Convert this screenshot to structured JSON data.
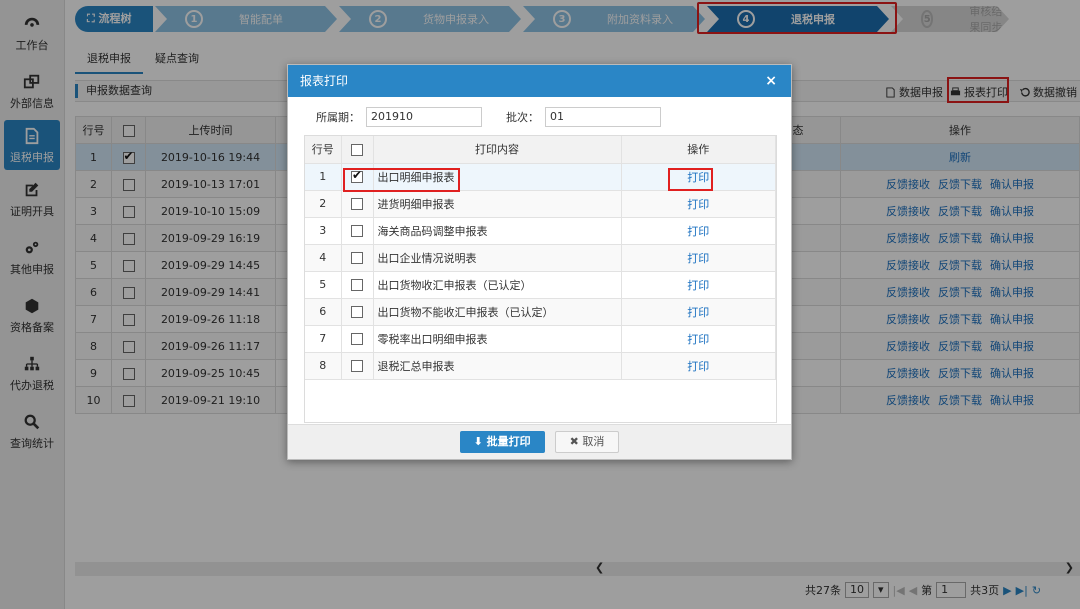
{
  "sidebar": {
    "items": [
      {
        "label": "工作台",
        "icon": "dashboard-icon"
      },
      {
        "label": "外部信息",
        "icon": "windows-icon"
      },
      {
        "label": "退税申报",
        "icon": "document-icon",
        "active": true
      },
      {
        "label": "证明开具",
        "icon": "edit-icon"
      },
      {
        "label": "其他申报",
        "icon": "gears-icon"
      },
      {
        "label": "资格备案",
        "icon": "cube-icon"
      },
      {
        "label": "代办退税",
        "icon": "hierarchy-icon"
      },
      {
        "label": "查询统计",
        "icon": "search-icon"
      }
    ]
  },
  "flow": {
    "root": "流程树",
    "steps": [
      {
        "num": "1",
        "label": "智能配单"
      },
      {
        "num": "2",
        "label": "货物申报录入"
      },
      {
        "num": "3",
        "label": "附加资料录入"
      },
      {
        "num": "4",
        "label": "退税申报"
      },
      {
        "num": "5",
        "label": "审核结果同步"
      }
    ]
  },
  "tabs": [
    "退税申报",
    "疑点查询"
  ],
  "panel": {
    "title": "申报数据查询",
    "actions": [
      "数据申报",
      "报表打印",
      "数据撤销"
    ]
  },
  "main_table": {
    "headers": {
      "row": "行号",
      "time": "上传时间",
      "partial": "态",
      "ops": "操作"
    },
    "rows": [
      {
        "no": "1",
        "time": "2019-10-16 19:44",
        "checked": true,
        "ops": [
          "刷新"
        ]
      },
      {
        "no": "2",
        "time": "2019-10-13 17:01",
        "ops": [
          "反馈接收",
          "反馈下载",
          "确认申报"
        ]
      },
      {
        "no": "3",
        "time": "2019-10-10 15:09",
        "ops": [
          "反馈接收",
          "反馈下载",
          "确认申报"
        ]
      },
      {
        "no": "4",
        "time": "2019-09-29 16:19",
        "ops": [
          "反馈接收",
          "反馈下载",
          "确认申报"
        ]
      },
      {
        "no": "5",
        "time": "2019-09-29 14:45",
        "ops": [
          "反馈接收",
          "反馈下载",
          "确认申报"
        ]
      },
      {
        "no": "6",
        "time": "2019-09-29 14:41",
        "ops": [
          "反馈接收",
          "反馈下载",
          "确认申报"
        ]
      },
      {
        "no": "7",
        "time": "2019-09-26 11:18",
        "ops": [
          "反馈接收",
          "反馈下载",
          "确认申报"
        ]
      },
      {
        "no": "8",
        "time": "2019-09-26 11:17",
        "ops": [
          "反馈接收",
          "反馈下载",
          "确认申报"
        ]
      },
      {
        "no": "9",
        "time": "2019-09-25 10:45",
        "ops": [
          "反馈接收",
          "反馈下载",
          "确认申报"
        ]
      },
      {
        "no": "10",
        "time": "2019-09-21 19:10",
        "ops": [
          "反馈接收",
          "反馈下载",
          "确认申报"
        ]
      }
    ]
  },
  "pager": {
    "total": "共27条",
    "page_size": "10",
    "page_label": "第",
    "page": "1",
    "pages": "共3页"
  },
  "modal": {
    "title": "报表打印",
    "close": "×",
    "period_label": "所属期：",
    "period_value": "201910",
    "batch_label": "批次：",
    "batch_value": "01",
    "headers": {
      "row": "行号",
      "content": "打印内容",
      "ops": "操作"
    },
    "rows": [
      {
        "no": "1",
        "content": "出口明细申报表",
        "action": "打印",
        "checked": true
      },
      {
        "no": "2",
        "content": "进货明细申报表",
        "action": "打印"
      },
      {
        "no": "3",
        "content": "海关商品码调整申报表",
        "action": "打印"
      },
      {
        "no": "4",
        "content": "出口企业情况说明表",
        "action": "打印"
      },
      {
        "no": "5",
        "content": "出口货物收汇申报表（已认定）",
        "action": "打印"
      },
      {
        "no": "6",
        "content": "出口货物不能收汇申报表（已认定）",
        "action": "打印"
      },
      {
        "no": "7",
        "content": "零税率出口明细申报表",
        "action": "打印"
      },
      {
        "no": "8",
        "content": "退税汇总申报表",
        "action": "打印"
      }
    ],
    "batch_print": "批量打印",
    "cancel": "取消"
  }
}
